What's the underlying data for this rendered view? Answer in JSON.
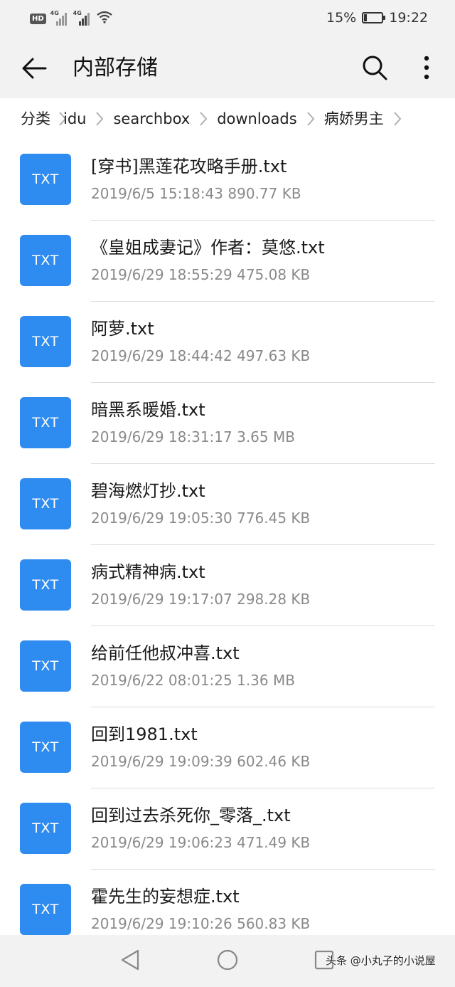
{
  "status_bar": {
    "badge": "HD",
    "network_1": "4G",
    "network_2": "4G",
    "battery_text": "15%",
    "battery_level": 0.15,
    "time": "19:22"
  },
  "app_bar": {
    "title": "内部存储",
    "back_icon": "arrow-left-icon",
    "search_icon": "search-icon",
    "more_icon": "more-vertical-icon"
  },
  "breadcrumb": {
    "items": [
      "分类",
      "idu",
      "searchbox",
      "downloads",
      "病娇男主"
    ],
    "separator_icon": "chevron-right-icon"
  },
  "files": [
    {
      "icon_label": "TXT",
      "name": "[穿书]黑莲花攻略手册.txt",
      "meta": "2019/6/5 15:18:43 890.77 KB"
    },
    {
      "icon_label": "TXT",
      "name": "《皇姐成妻记》作者：莫悠.txt",
      "meta": "2019/6/29 18:55:29 475.08 KB"
    },
    {
      "icon_label": "TXT",
      "name": "阿萝.txt",
      "meta": "2019/6/29 18:44:42 497.63 KB"
    },
    {
      "icon_label": "TXT",
      "name": "暗黑系暖婚.txt",
      "meta": "2019/6/29 18:31:17 3.65 MB"
    },
    {
      "icon_label": "TXT",
      "name": "碧海燃灯抄.txt",
      "meta": "2019/6/29 19:05:30 776.45 KB"
    },
    {
      "icon_label": "TXT",
      "name": "病式精神病.txt",
      "meta": "2019/6/29 19:17:07 298.28 KB"
    },
    {
      "icon_label": "TXT",
      "name": "给前任他叔冲喜.txt",
      "meta": "2019/6/22 08:01:25 1.36 MB"
    },
    {
      "icon_label": "TXT",
      "name": "回到1981.txt",
      "meta": "2019/6/29 19:09:39 602.46 KB"
    },
    {
      "icon_label": "TXT",
      "name": "回到过去杀死你_零落_.txt",
      "meta": "2019/6/29 19:06:23 471.49 KB"
    },
    {
      "icon_label": "TXT",
      "name": "霍先生的妄想症.txt",
      "meta": "2019/6/29 19:10:26 560.83 KB"
    }
  ],
  "nav_bar": {
    "back_icon": "triangle-back-icon",
    "home_icon": "circle-home-icon",
    "recent_icon": "square-recent-icon"
  },
  "watermark": "头条 @小丸子的小说屋",
  "colors": {
    "accent": "#2e8bf0",
    "background": "#f2f2f2",
    "list_background": "#ffffff",
    "secondary_text": "#8a8a8a"
  }
}
